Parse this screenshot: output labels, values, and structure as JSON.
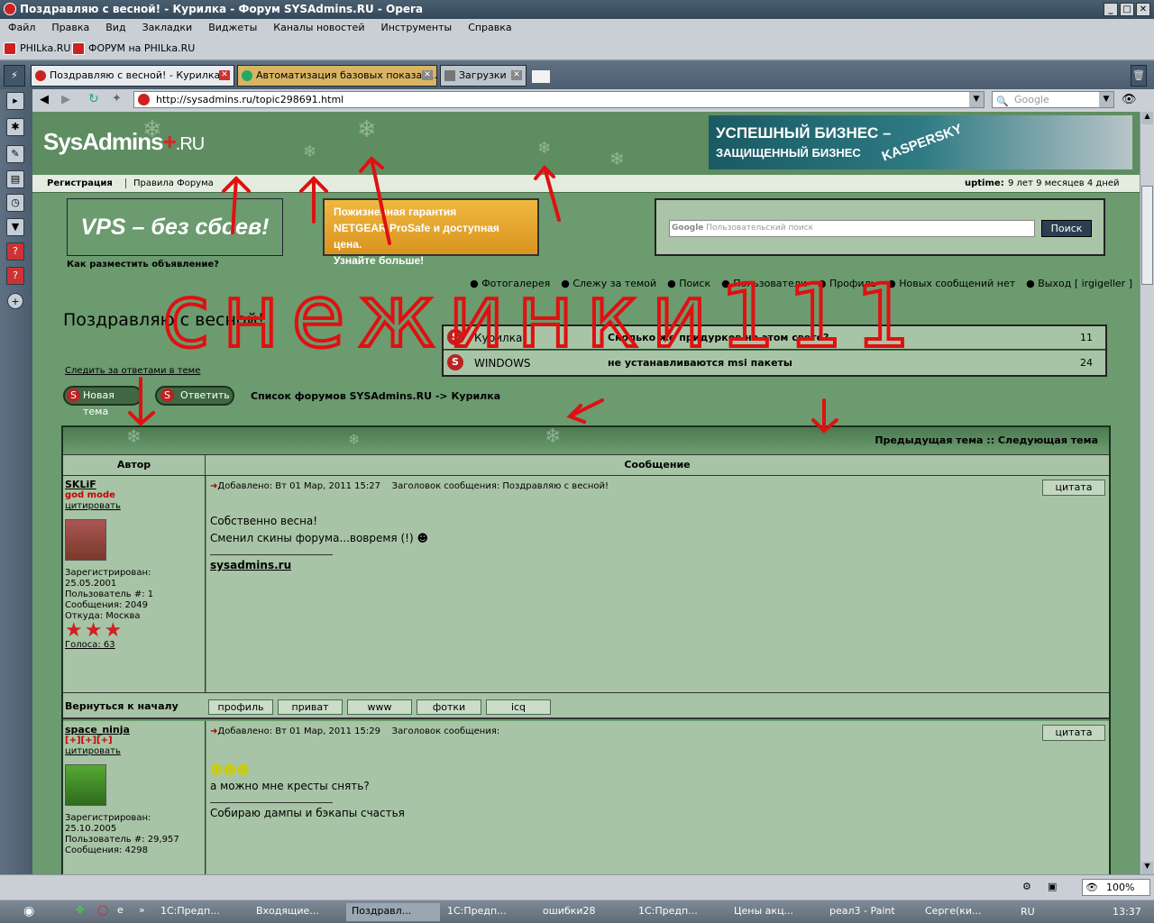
{
  "window": {
    "title": "Поздравляю с весной! - Курилка - Форум SYSAdmins.RU - Opera"
  },
  "menu": [
    "Файл",
    "Правка",
    "Вид",
    "Закладки",
    "Виджеты",
    "Каналы новостей",
    "Инструменты",
    "Справка"
  ],
  "bookmarks": [
    "PHILka.RU",
    "ФОРУМ на PHILka.RU"
  ],
  "tabs": [
    {
      "label": "Поздравляю с весной! - Курилка..."
    },
    {
      "label": "Автоматизация базовых показат..."
    },
    {
      "label": "Загрузки"
    }
  ],
  "address": {
    "url": "http://sysadmins.ru/topic298691.html",
    "search_placeholder": "Google"
  },
  "site": {
    "logo": "SysAdmins",
    "logo_ru": ".RU",
    "banner_top": {
      "line1": "УСПЕШНЫЙ БИЗНЕС –",
      "line2": "ЗАЩИЩЕННЫЙ БИЗНЕС",
      "brand": "KASPERSKY"
    },
    "nav": {
      "register": "Регистрация",
      "rules": "Правила Форума",
      "uptime_label": "uptime:",
      "uptime_value": "9 лет 9 месяцев 4 дней"
    },
    "ad_vps": "VPS – без сбоев!",
    "ad_how": "Как разместить объявление?",
    "ad_netgear": {
      "l1": "Пожизненная гарантия",
      "l2": "NETGEAR ProSafe и доступная цена.",
      "l3": "Узнайте больше!"
    },
    "search": {
      "placeholder": "Пользовательский поиск",
      "button": "Поиск",
      "google": "Google"
    },
    "links": [
      "Фотогалерея",
      "Слежу за темой",
      "Поиск",
      "Пользователи",
      "Профиль",
      "Новых сообщений нет",
      "Выход [ irgigeller ]"
    ],
    "topic_title": "Поздравляю с весной!",
    "watch": "Следить за ответами в теме",
    "new_topic": "Новая тема",
    "reply": "Ответить",
    "breadcrumb": "Список форумов SYSAdmins.RU -> Курилка",
    "related": [
      {
        "forum": "Курилка",
        "title": "Сколько же придурков на этом свете?",
        "count": "11"
      },
      {
        "forum": "WINDOWS",
        "title": "не устанавливаются msi пакеты",
        "count": "24"
      }
    ],
    "prevnext": "Предыдущая тема :: Следующая тема",
    "col_author": "Автор",
    "col_message": "Сообщение",
    "posts": [
      {
        "author": "SKLiF",
        "rank": "god mode",
        "quote_link": "цитировать",
        "added": "Добавлено: Вт 01 Мар, 2011 15:27",
        "subject": "Заголовок сообщения: Поздравляю с весной!",
        "quote_btn": "цитата",
        "text1": "Собственно весна!",
        "text2": "Сменил скины форума...вовремя (!)",
        "sig": "sysadmins.ru",
        "info": [
          "Зарегистрирован:",
          "25.05.2001",
          "Пользователь #: 1",
          "Сообщения: 2049",
          "Откуда: Москва"
        ],
        "votes": "Голоса: 63"
      },
      {
        "author": "space_ninja",
        "rank": "[+][+][+]",
        "quote_link": "цитировать",
        "added": "Добавлено: Вт 01 Мар, 2011 15:29",
        "subject": "Заголовок сообщения:",
        "quote_btn": "цитата",
        "text1": "а можно мне кресты снять?",
        "sig": "Собираю дампы и бэкапы счастья",
        "info": [
          "Зарегистрирован:",
          "25.10.2005",
          "Пользователь #: 29,957",
          "Сообщения: 4298"
        ]
      }
    ],
    "back_top": "Вернуться к началу",
    "post_buttons": [
      "профиль",
      "приват",
      "www",
      "фотки",
      "icq"
    ]
  },
  "annotation": {
    "scrawl": "снежинки111"
  },
  "status": {
    "zoom": "100%"
  },
  "taskbar": {
    "items": [
      "1С:Предп...",
      "Входящие...",
      "Поздравл...",
      "1С:Предп...",
      "ошибки28",
      "1С:Предп...",
      "Цены акц...",
      "реал3 - Paint",
      "Серге(ки..."
    ],
    "lang": "RU",
    "time": "13:37"
  }
}
